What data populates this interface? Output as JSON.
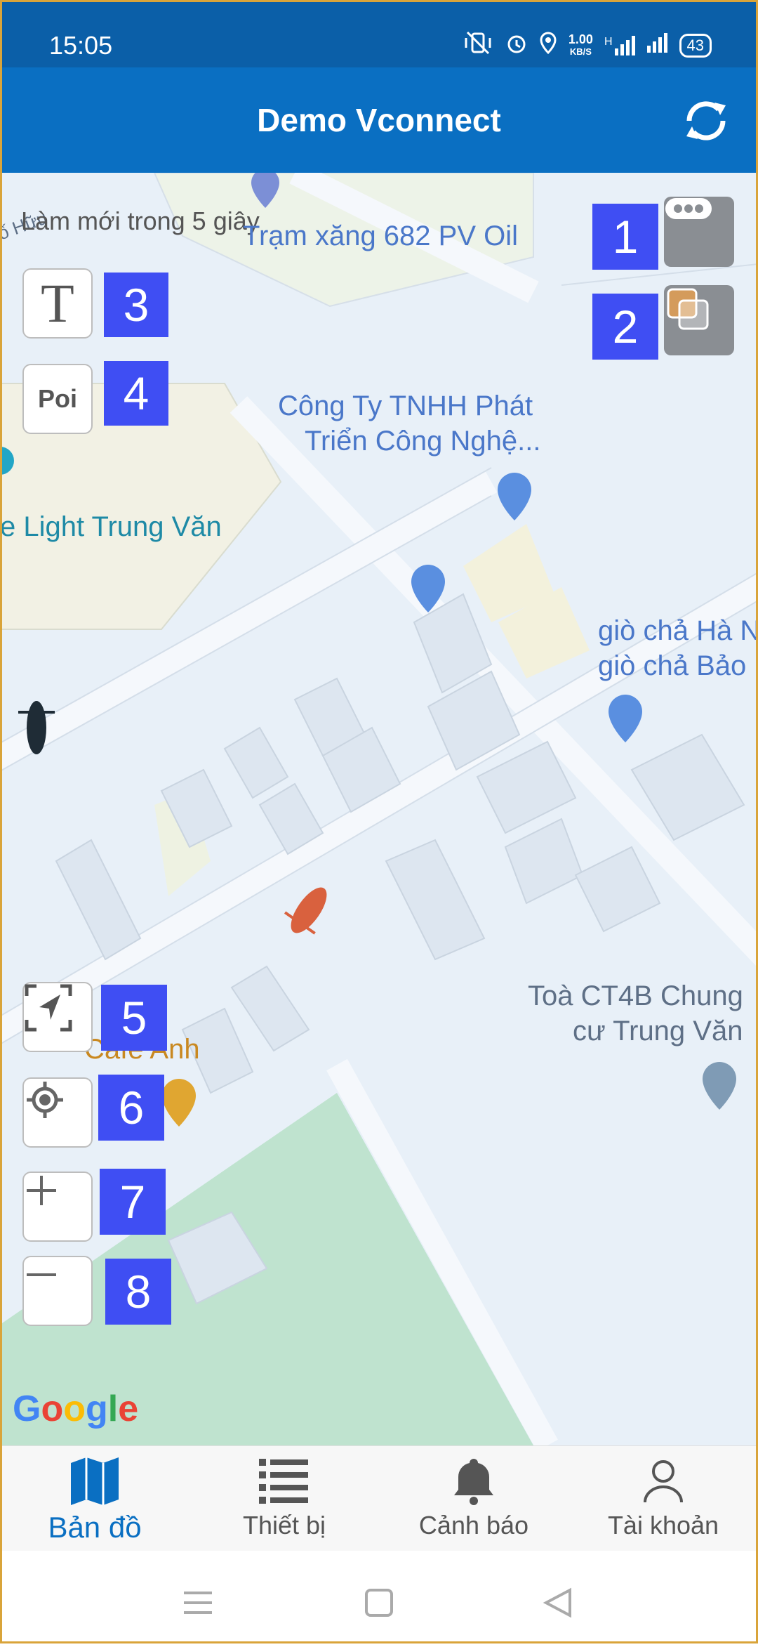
{
  "status": {
    "time": "15:05",
    "net_speed_top": "1.00",
    "net_speed_bottom": "KB/S",
    "network": "H",
    "battery": "43"
  },
  "app": {
    "title": "Demo Vconnect"
  },
  "map": {
    "refresh_notice": "Làm mới trong 5 giây",
    "partial_label": "ố Hữu",
    "labels": {
      "gas_station": "Trạm xăng 682 PV Oil",
      "company_line1": "Công Ty TNHH Phát",
      "company_line2": "Triển Công Nghệ...",
      "light": "e Light Trung Văn",
      "gio_cha_line1": "giò chả Hà N",
      "gio_cha_line2": "giò chả Bảo",
      "cafe": "Cafe Anh",
      "toa_line1": "Toà CT4B Chung",
      "toa_line2": "cư Trung Văn"
    },
    "google": [
      "G",
      "o",
      "o",
      "g",
      "l",
      "e"
    ],
    "google_colors": [
      "#4285F4",
      "#EA4335",
      "#FBBC05",
      "#4285F4",
      "#34A853",
      "#EA4335"
    ]
  },
  "controls": {
    "text_icon": "T",
    "poi_label": "Poi"
  },
  "badges": [
    "1",
    "2",
    "3",
    "4",
    "5",
    "6",
    "7",
    "8"
  ],
  "nav": {
    "items": [
      {
        "label": "Bản đồ"
      },
      {
        "label": "Thiết bị"
      },
      {
        "label": "Cảnh báo"
      },
      {
        "label": "Tài khoản"
      }
    ]
  },
  "colors": {
    "primary": "#0a6fc2",
    "badge": "#3f4ef3",
    "park": "#bfe3cf"
  }
}
